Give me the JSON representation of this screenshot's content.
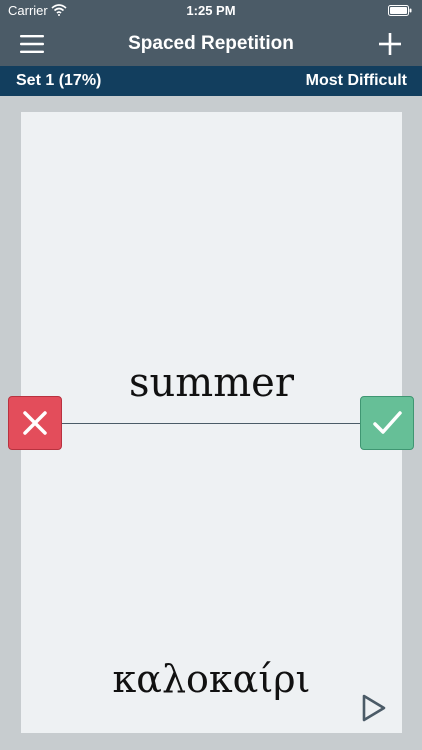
{
  "status_bar": {
    "carrier": "Carrier",
    "time": "1:25 PM",
    "wifi_icon": "wifi-icon",
    "battery_icon": "battery-icon"
  },
  "nav_bar": {
    "title": "Spaced Repetition",
    "menu_icon": "hamburger-menu-icon",
    "add_icon": "plus-icon"
  },
  "set_bar": {
    "set_label": "Set 1 (17%)",
    "mode_label": "Most Difficult"
  },
  "card": {
    "front": "summer",
    "back": "καλοκαίρι",
    "wrong_icon": "x-icon",
    "right_icon": "checkmark-icon",
    "play_icon": "play-icon"
  },
  "colors": {
    "nav": "#4b5b67",
    "set_bar": "#123e5e",
    "card": "#eef1f3",
    "wrong": "#e34d5b",
    "right": "#66bf97"
  }
}
